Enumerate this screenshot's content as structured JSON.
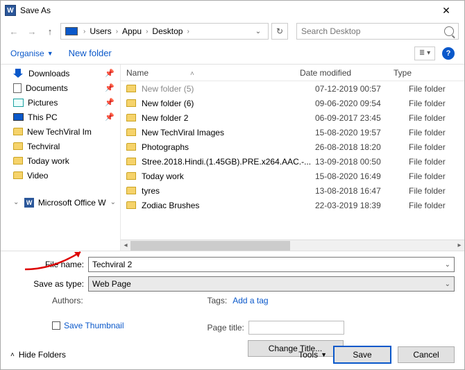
{
  "window": {
    "title": "Save As"
  },
  "nav": {
    "address_root_icon": "pc-icon",
    "breadcrumbs": [
      "Users",
      "Appu",
      "Desktop"
    ],
    "search_placeholder": "Search Desktop"
  },
  "cmdbar": {
    "organise": "Organise",
    "newfolder": "New folder"
  },
  "tree": {
    "items": [
      {
        "label": "Downloads",
        "icon": "dl",
        "pinned": true
      },
      {
        "label": "Documents",
        "icon": "doc",
        "pinned": true
      },
      {
        "label": "Pictures",
        "icon": "pic",
        "pinned": true
      },
      {
        "label": "This PC",
        "icon": "pc",
        "pinned": true
      },
      {
        "label": "New TechViral Im",
        "icon": "fold",
        "pinned": false
      },
      {
        "label": "Techviral",
        "icon": "fold",
        "pinned": false
      },
      {
        "label": "Today work",
        "icon": "fold",
        "pinned": false
      },
      {
        "label": "Video",
        "icon": "fold",
        "pinned": false
      }
    ],
    "footer_item": {
      "label": "Microsoft Office W",
      "icon": "word"
    }
  },
  "columns": {
    "name": "Name",
    "date": "Date modified",
    "type": "Type"
  },
  "files": [
    {
      "name": "New folder (5)",
      "date": "07-12-2019 00:57",
      "type": "File folder",
      "cut": true
    },
    {
      "name": "New folder (6)",
      "date": "09-06-2020 09:54",
      "type": "File folder"
    },
    {
      "name": "New folder 2",
      "date": "06-09-2017 23:45",
      "type": "File folder"
    },
    {
      "name": "New TechViral Images",
      "date": "15-08-2020 19:57",
      "type": "File folder"
    },
    {
      "name": "Photographs",
      "date": "26-08-2018 18:20",
      "type": "File folder"
    },
    {
      "name": "Stree.2018.Hindi.(1.45GB).PRE.x264.AAC.-...",
      "date": "13-09-2018 00:50",
      "type": "File folder"
    },
    {
      "name": "Today work",
      "date": "15-08-2020 16:49",
      "type": "File folder"
    },
    {
      "name": "tyres",
      "date": "13-08-2018 16:47",
      "type": "File folder"
    },
    {
      "name": "Zodiac Brushes",
      "date": "22-03-2019 18:39",
      "type": "File folder"
    }
  ],
  "form": {
    "filename_label": "File name:",
    "filename_value": "Techviral 2",
    "savetype_label": "Save as type:",
    "savetype_value": "Web Page",
    "authors_label": "Authors:",
    "tags_label": "Tags:",
    "tags_value": "Add a tag",
    "save_thumb": "Save Thumbnail",
    "page_title_label": "Page title:",
    "change_title": "Change Title..."
  },
  "bottom": {
    "hide_folders": "Hide Folders",
    "tools": "Tools",
    "save": "Save",
    "cancel": "Cancel"
  }
}
